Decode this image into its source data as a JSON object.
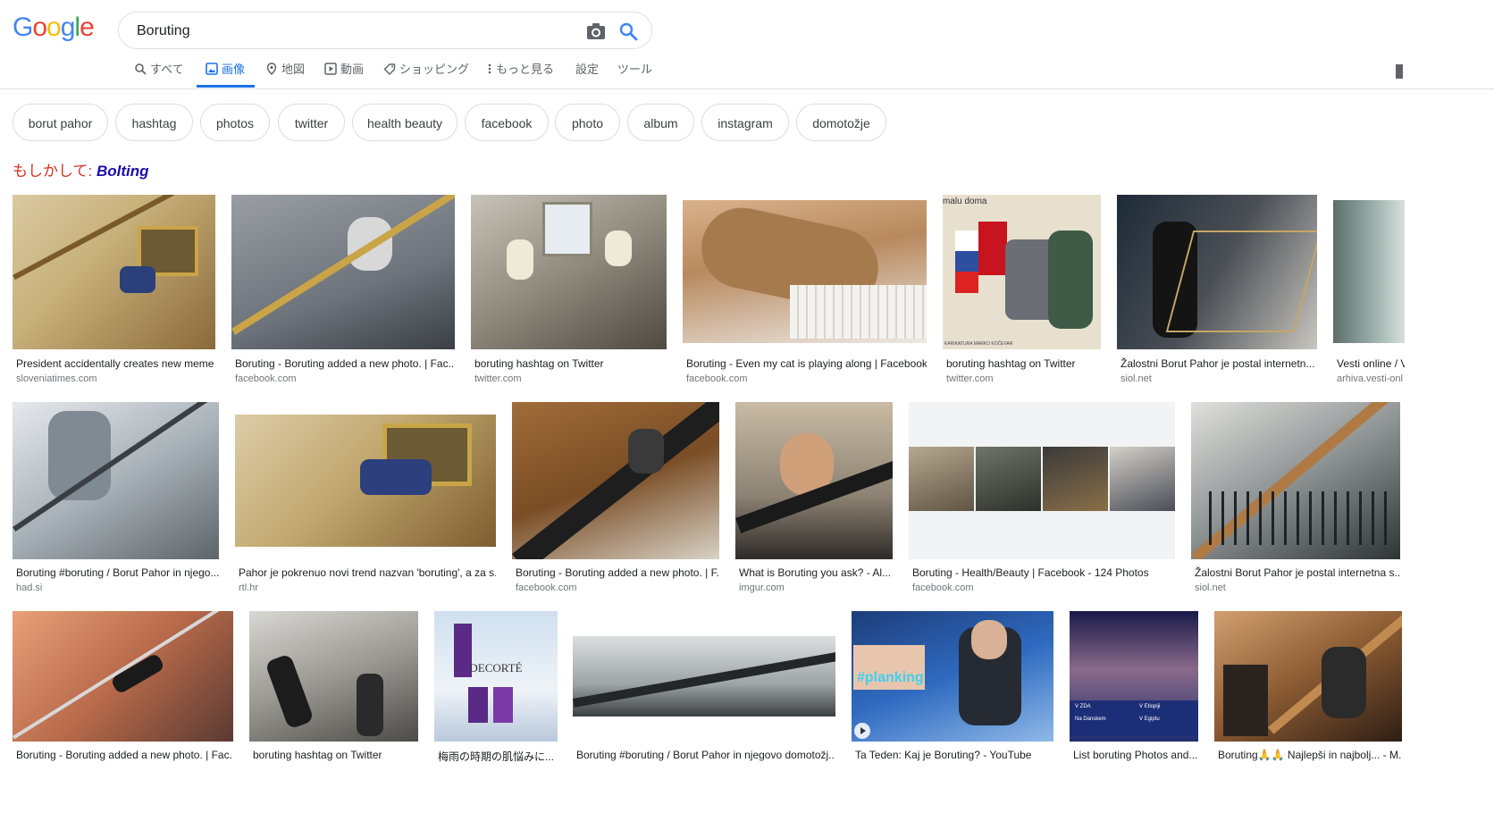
{
  "header": {
    "logo": [
      "G",
      "o",
      "o",
      "g",
      "l",
      "e"
    ],
    "logo_colors": [
      "#4285f4",
      "#ea4335",
      "#fbbc05",
      "#4285f4",
      "#34a853",
      "#ea4335"
    ],
    "search_value": "Boruting",
    "tabs": [
      "すべて",
      "画像",
      "地図",
      "動画",
      "ショッピング",
      "もっと見る",
      "設定",
      "ツール"
    ]
  },
  "chips": [
    "borut pahor",
    "hashtag",
    "photos",
    "twitter",
    "health beauty",
    "facebook",
    "photo",
    "album",
    "instagram",
    "domotožje"
  ],
  "did_you_mean": {
    "prefix": "もしかして:",
    "term": "Bolting"
  },
  "results": [
    {
      "title": "President accidentally creates new meme",
      "source": "sloveniatimes.com"
    },
    {
      "title": "Boruting - Boruting added a new photo. | Fac...",
      "source": "facebook.com"
    },
    {
      "title": "boruting hashtag on Twitter",
      "source": "twitter.com"
    },
    {
      "title": "Boruting - Even my cat is playing along | Facebook",
      "source": "facebook.com"
    },
    {
      "title": "boruting hashtag on Twitter",
      "source": "twitter.com"
    },
    {
      "title": "Žalostni Borut Pahor je postal internetn...",
      "source": "siol.net"
    },
    {
      "title": "Vesti online / V",
      "source": "arhiva.vesti-onl"
    },
    {
      "title": "Boruting #boruting / Borut Pahor in njego...",
      "source": "had.si"
    },
    {
      "title": "Pahor je pokrenuo novi trend nazvan 'boruting', a za s...",
      "source": "rtl.hr"
    },
    {
      "title": "Boruting - Boruting added a new photo. | F...",
      "source": "facebook.com"
    },
    {
      "title": "What is Boruting you ask? - Al...",
      "source": "imgur.com"
    },
    {
      "title": "Boruting - Health/Beauty | Facebook - 124 Photos",
      "source": "facebook.com"
    },
    {
      "title": "Žalostni Borut Pahor je postal internetna s...",
      "source": "siol.net"
    },
    {
      "title": "Boruting - Boruting added a new photo. | Fac...",
      "source": ""
    },
    {
      "title": "boruting hashtag on Twitter",
      "source": ""
    },
    {
      "title": "梅雨の時期の肌悩みに...",
      "source": ""
    },
    {
      "title": "Boruting #boruting / Borut Pahor in njegovo domotožj...",
      "source": ""
    },
    {
      "title": "Ta Teden: Kaj je Boruting? - YouTube",
      "source": ""
    },
    {
      "title": "List boruting Photos and...",
      "source": ""
    },
    {
      "title": "Boruting🙏🙏 Najlepši in najbolj... - M...",
      "source": ""
    }
  ],
  "thumb_text": {
    "caricature_caption": "malu doma",
    "caricature_credit": "KARIKATURA MARKO KOČEVAR",
    "cosmetics_brand": "DECORTÉ",
    "tv_tag": "#planking",
    "tv_lines": [
      "V ZDA",
      "V Etiopiji",
      "Na Danskem",
      "V Egiptu"
    ]
  },
  "colors": {
    "accent": "#1a73e8",
    "link": "#1a0dab",
    "correction": "#d93025"
  }
}
